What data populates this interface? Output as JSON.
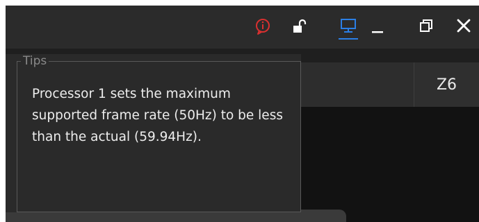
{
  "titlebar": {
    "icons": [
      {
        "name": "alert-icon",
        "color": "#d93030"
      },
      {
        "name": "unlock-icon",
        "color": "#ffffff"
      },
      {
        "name": "monitor-icon",
        "color": "#2b7fe6"
      },
      {
        "name": "minimize-icon",
        "color": "#ffffff"
      },
      {
        "name": "restore-icon",
        "color": "#ffffff"
      },
      {
        "name": "close-icon",
        "color": "#ffffff"
      }
    ]
  },
  "toolbar": {
    "zone_label": "Z6"
  },
  "tips": {
    "title": "Tips",
    "message": "Processor 1 sets the maximum supported frame rate (50Hz) to be less than the actual (59.94Hz)."
  },
  "colors": {
    "accent": "#2b7fe6",
    "alert": "#d93030",
    "background": "#1f1f1f"
  }
}
